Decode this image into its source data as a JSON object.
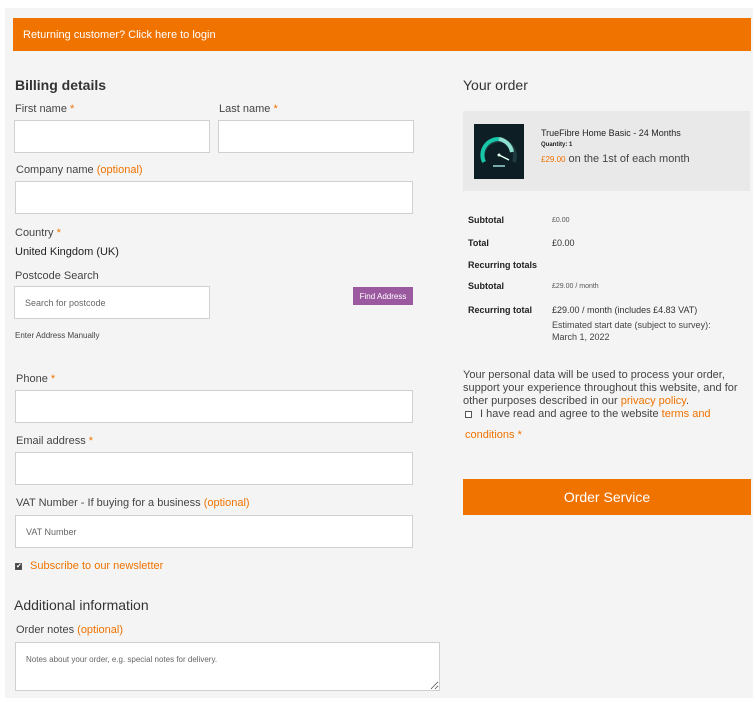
{
  "login_bar": {
    "text": "Returning customer? Click here to login"
  },
  "billing": {
    "heading": "Billing details",
    "first_name_label": "First name",
    "last_name_label": "Last name",
    "company_label": "Company name",
    "optional": "(optional)",
    "country_label": "Country",
    "country_value": "United Kingdom (UK)",
    "postcode_label": "Postcode Search",
    "postcode_placeholder": "Search for postcode",
    "find_button": "Find Address",
    "manual_link": "Enter Address Manually",
    "phone_label": "Phone",
    "email_label": "Email address",
    "vat_label": "VAT Number - If buying for a business",
    "vat_placeholder": "VAT Number",
    "subscribe_label": "Subscribe to our newsletter",
    "required_mark": "*",
    "checkbox_mark": "✔"
  },
  "additional": {
    "heading": "Additional information",
    "notes_label": "Order notes",
    "notes_placeholder": "Notes about your order, e.g. special notes for delivery."
  },
  "order": {
    "heading": "Your order",
    "product": {
      "title": "TrueFibre Home Basic - 24 Months",
      "quantity": "Quantity: 1",
      "price": "£29.00",
      "schedule": "on the 1st of each month",
      "image_icon": "speedometer-icon"
    },
    "subtotal_label": "Subtotal",
    "subtotal_value": "£0.00",
    "total_label": "Total",
    "total_value": "£0.00",
    "recurring_totals_label": "Recurring totals",
    "recurring_subtotal_label": "Subtotal",
    "recurring_subtotal_value": "£29.00 / month",
    "recurring_total_label": "Recurring total",
    "recurring_total_amount": "£29.00",
    "recurring_total_rest": "/ month (includes £4.83 VAT)",
    "start_date_line1": "Estimated start date (subject to survey):",
    "start_date_line2": "March 1, 2022",
    "privacy_text": "Your personal data will be used to process your order, support your experience throughout this website, and for other purposes described in our",
    "privacy_link": "privacy policy",
    "privacy_end": ".",
    "terms_text": "I have read and agree to the website",
    "terms_link": "terms and conditions",
    "order_button": "Order Service"
  },
  "colors": {
    "accent": "#f07300",
    "find_button": "#9b59a0",
    "background": "#f4f4f4"
  }
}
